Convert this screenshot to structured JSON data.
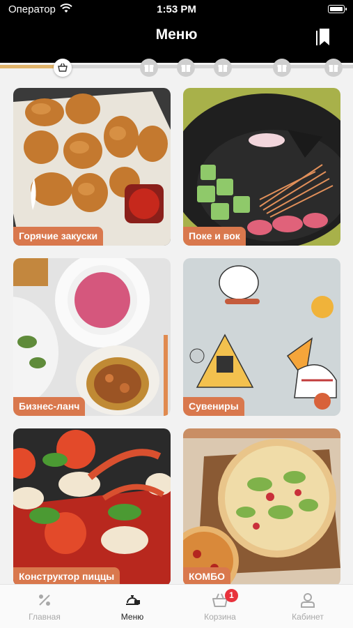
{
  "status_bar": {
    "carrier": "Оператор",
    "time": "1:53 PM"
  },
  "header": {
    "title": "Меню"
  },
  "progress": {
    "fraction": 0.16,
    "steps": 7
  },
  "categories": [
    {
      "label": "Горячие закуски"
    },
    {
      "label": "Поке и вок"
    },
    {
      "label": "Бизнес-ланч"
    },
    {
      "label": "Сувениры"
    },
    {
      "label": "Конструктор пиццы"
    },
    {
      "label": "КОМБО"
    }
  ],
  "tabbar": {
    "items": [
      {
        "label": "Главная"
      },
      {
        "label": "Меню"
      },
      {
        "label": "Корзина"
      },
      {
        "label": "Кабинет"
      }
    ],
    "cart_count": "1"
  },
  "colors": {
    "accent": "#d9784d",
    "progress": "#e0b36a",
    "badge": "#e8323c"
  }
}
